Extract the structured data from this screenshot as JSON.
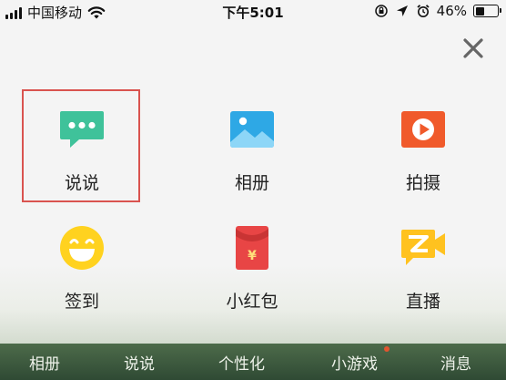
{
  "status_bar": {
    "carrier": "中国移动",
    "time": "下午5:01",
    "battery_percent": "46%",
    "battery_level": 0.46,
    "icons": [
      "signal-icon",
      "wifi-icon",
      "orientation-lock-icon",
      "location-icon",
      "alarm-icon",
      "battery-icon"
    ]
  },
  "close_icon": "close-icon",
  "actions": [
    {
      "label": "说说",
      "icon": "speech-bubble-icon",
      "color": "#3fc29a",
      "selected": true
    },
    {
      "label": "相册",
      "icon": "photo-album-icon",
      "color": "#2ea8e5"
    },
    {
      "label": "拍摄",
      "icon": "camera-play-icon",
      "color": "#f05a2b"
    },
    {
      "label": "签到",
      "icon": "smiley-icon",
      "color": "#ffd21f"
    },
    {
      "label": "小红包",
      "icon": "red-envelope-icon",
      "color": "#e84545"
    },
    {
      "label": "直播",
      "icon": "live-stream-icon",
      "color": "#ffc21f"
    }
  ],
  "bottom_nav": [
    {
      "label": "相册"
    },
    {
      "label": "说说"
    },
    {
      "label": "个性化"
    },
    {
      "label": "小游戏",
      "badge_dot": true
    },
    {
      "label": "消息"
    }
  ],
  "colors": {
    "selection_border": "#d9534f",
    "nav_background": "#3a5a3e"
  }
}
